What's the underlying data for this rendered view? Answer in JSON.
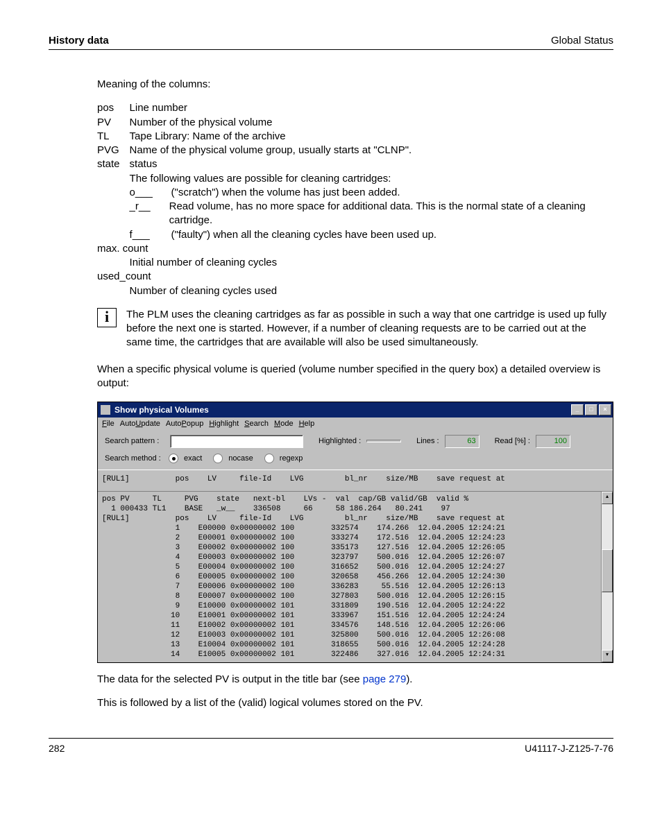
{
  "header": {
    "left": "History data",
    "right": "Global Status"
  },
  "intro": "Meaning of the columns:",
  "defs": {
    "pos": {
      "term": "pos",
      "desc": "Line number"
    },
    "pv": {
      "term": "PV",
      "desc": "Number of the physical volume"
    },
    "tl": {
      "term": "TL",
      "desc": "Tape Library: Name of the archive"
    },
    "pvg": {
      "term": "PVG",
      "desc": "Name of the physical volume group, usually starts at \"CLNP\"."
    },
    "state": {
      "term": "state",
      "desc": "status",
      "note": "The following values are possible for cleaning cartridges:",
      "vals": [
        {
          "code": "o___",
          "text": "(\"scratch\") when the volume has just been added."
        },
        {
          "code": "_r__",
          "text": "Read volume, has no more space for additional data. This is the normal state of a cleaning cartridge."
        },
        {
          "code": "f___",
          "text": "(\"faulty\") when all the cleaning cycles have been used up."
        }
      ]
    },
    "maxcount": {
      "term": "max. count",
      "desc": "Initial number of cleaning cycles"
    },
    "usedcount": {
      "term": "used_count",
      "desc": "Number of cleaning cycles used"
    }
  },
  "infobox": "The PLM uses the cleaning cartridges as far as possible in such a way that one cartridge is used up fully before the next one is started. However, if a number of cleaning requests are to be carried out at the same time, the cartridges that are available will also be used simultaneously.",
  "followup": "When a specific physical volume is queried (volume number specified in the query box) a detailed overview is output:",
  "ss": {
    "title": "Show physical Volumes",
    "winbtns": {
      "min": "_",
      "max": "□",
      "close": "×"
    },
    "menu": [
      "File",
      "AutoUpdate",
      "AutoPopup",
      "Highlight",
      "Search",
      "Mode",
      "Help"
    ],
    "toolbar": {
      "search_pattern": "Search pattern :",
      "highlighted": "Highlighted :",
      "lines": "Lines :",
      "lines_val": "63",
      "readpct": "Read [%] :",
      "readpct_val": "100",
      "search_method": "Search method :",
      "radio1": "exact",
      "radio2": "nocase",
      "radio3": "regexp"
    },
    "header_line": "[RUL1]          pos    LV     file-Id    LVG         bl_nr    size/MB    save request at",
    "body_head1": "pos PV     TL     PVG    state   next-bl    LVs -  val  cap/GB valid/GB  valid %",
    "body_head2": "  1 000433 TL1    BASE   _w__    336508     66     58 186.264   80.241    97",
    "body_head3": "[RUL1]          pos    LV     file-Id    LVG         bl_nr    size/MB    save request at",
    "rows": [
      "                1    E00000 0x00000002 100        332574    174.266  12.04.2005 12:24:21",
      "                2    E00001 0x00000002 100        333274    172.516  12.04.2005 12:24:23",
      "                3    E00002 0x00000002 100        335173    127.516  12.04.2005 12:26:05",
      "                4    E00003 0x00000002 100        323797    500.016  12.04.2005 12:26:07",
      "                5    E00004 0x00000002 100        316652    500.016  12.04.2005 12:24:27",
      "                6    E00005 0x00000002 100        320658    456.266  12.04.2005 12:24:30",
      "                7    E00006 0x00000002 100        336283     55.516  12.04.2005 12:26:13",
      "                8    E00007 0x00000002 100        327803    500.016  12.04.2005 12:26:15",
      "                9    E10000 0x00000002 101        331809    190.516  12.04.2005 12:24:22",
      "               10    E10001 0x00000002 101        333967    151.516  12.04.2005 12:24:24",
      "               11    E10002 0x00000002 101        334576    148.516  12.04.2005 12:26:06",
      "               12    E10003 0x00000002 101        325800    500.016  12.04.2005 12:26:08",
      "               13    E10004 0x00000002 101        318655    500.016  12.04.2005 12:24:28",
      "               14    E10005 0x00000002 101        322486    327.016  12.04.2005 12:24:31"
    ]
  },
  "after1": {
    "pre": "The data for the selected PV is output in the title bar (see ",
    "link": "page 279",
    "post": ")."
  },
  "after2": "This is followed by a list of the (valid) logical volumes stored on the PV.",
  "footer": {
    "page": "282",
    "docid": "U41117-J-Z125-7-76"
  }
}
